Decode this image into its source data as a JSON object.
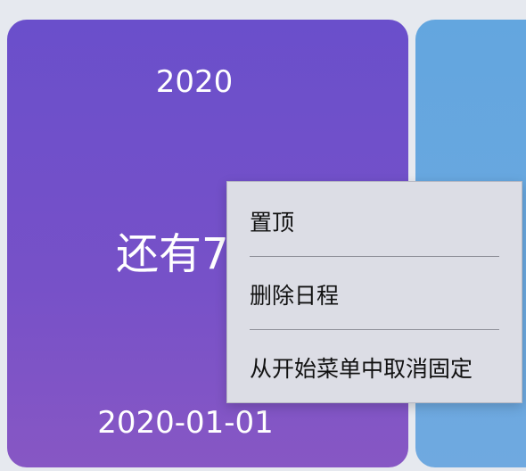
{
  "cards": [
    {
      "year": "2020",
      "countdown": "还有7",
      "date": "2020-01-01",
      "color": "#6e50c9"
    },
    {
      "color": "#66a7df"
    }
  ],
  "context_menu": {
    "items": [
      {
        "label": "置顶"
      },
      {
        "label": "删除日程"
      },
      {
        "label": "从开始菜单中取消固定"
      }
    ]
  }
}
